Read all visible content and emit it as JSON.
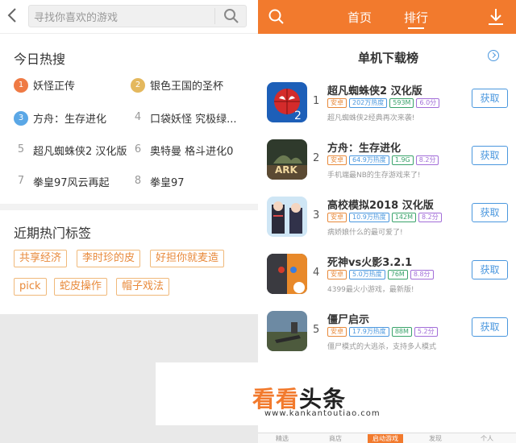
{
  "search": {
    "placeholder": "寻找你喜欢的游戏"
  },
  "hot_today": {
    "title": "今日热搜",
    "items": [
      {
        "rank": "1",
        "label": "妖怪正传"
      },
      {
        "rank": "2",
        "label": "银色王国的圣杯"
      },
      {
        "rank": "3",
        "label": "方舟：生存进化"
      },
      {
        "rank": "4",
        "label": "口袋妖怪 究极绿..."
      },
      {
        "rank": "5",
        "label": "超凡蜘蛛侠2 汉化版"
      },
      {
        "rank": "6",
        "label": "奥特曼 格斗进化0"
      },
      {
        "rank": "7",
        "label": "拳皇97风云再起"
      },
      {
        "rank": "8",
        "label": "拳皇97"
      }
    ]
  },
  "recent_tags": {
    "title": "近期热门标签",
    "tags": [
      "共享经济",
      "李时珍的皮",
      "好担你就麦造",
      "pick",
      "蛇皮操作",
      "帽子戏法"
    ]
  },
  "header": {
    "tab_home": "首页",
    "tab_rank": "排行"
  },
  "ranking": {
    "title": "单机下载榜",
    "games": [
      {
        "num": "1",
        "name": "超凡蜘蛛侠2 汉化版",
        "os": "安卓",
        "heat": "202万热度",
        "size": "593M",
        "score": "6.0分",
        "desc": "超凡蜘蛛侠2经典再次来袭!",
        "button": "获取"
      },
      {
        "num": "2",
        "name": "方舟：生存进化",
        "os": "安卓",
        "heat": "64.9万热度",
        "size": "1.9G",
        "score": "8.2分",
        "desc": "手机端最NB的生存游戏来了!",
        "button": "获取"
      },
      {
        "num": "3",
        "name": "高校模拟2018 汉化版",
        "os": "安卓",
        "heat": "10.9万热度",
        "size": "142M",
        "score": "8.2分",
        "desc": "病娇娘什么的最可爱了!",
        "button": "获取"
      },
      {
        "num": "4",
        "name": "死神vs火影3.2.1",
        "os": "安卓",
        "heat": "5.0万热度",
        "size": "76M",
        "score": "8.8分",
        "desc": "4399最火小游戏，最新版!",
        "button": "获取"
      },
      {
        "num": "5",
        "name": "僵尸启示",
        "os": "安卓",
        "heat": "17.9万热度",
        "size": "88M",
        "score": "5.2分",
        "desc": "僵尸模式的大逃杀，支持多人模式",
        "button": "获取"
      }
    ]
  },
  "bottom_nav": [
    "精选",
    "商店",
    "启动游戏",
    "发现",
    "个人"
  ],
  "watermark": {
    "title_a": "看看",
    "title_b": "头条",
    "url": "www.kankantoutiao.com"
  },
  "colors": {
    "accent": "#f27a2d",
    "blue": "#4a97de"
  }
}
